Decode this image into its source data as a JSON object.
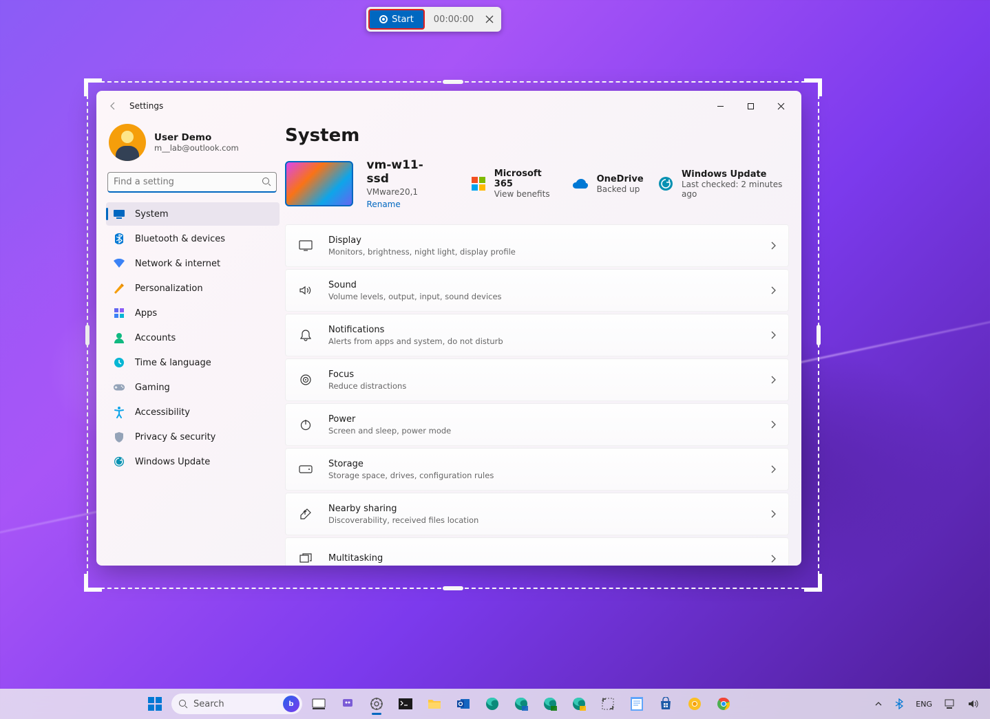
{
  "recorder": {
    "start_label": "Start",
    "time": "00:00:00"
  },
  "window": {
    "title": "Settings"
  },
  "user": {
    "name": "User Demo",
    "email": "m__lab@outlook.com"
  },
  "search": {
    "placeholder": "Find a setting"
  },
  "nav": [
    {
      "key": "system",
      "label": "System",
      "active": true,
      "color": "#0067c0"
    },
    {
      "key": "bluetooth",
      "label": "Bluetooth & devices",
      "color": "#0078d4"
    },
    {
      "key": "network",
      "label": "Network & internet",
      "color": "#3b82f6"
    },
    {
      "key": "personalization",
      "label": "Personalization",
      "color": "#f59e0b"
    },
    {
      "key": "apps",
      "label": "Apps",
      "color": "#6366f1"
    },
    {
      "key": "accounts",
      "label": "Accounts",
      "color": "#10b981"
    },
    {
      "key": "time",
      "label": "Time & language",
      "color": "#06b6d4"
    },
    {
      "key": "gaming",
      "label": "Gaming",
      "color": "#64748b"
    },
    {
      "key": "accessibility",
      "label": "Accessibility",
      "color": "#0ea5e9"
    },
    {
      "key": "privacy",
      "label": "Privacy & security",
      "color": "#94a3b8"
    },
    {
      "key": "update",
      "label": "Windows Update",
      "color": "#0891b2"
    }
  ],
  "page": {
    "title": "System"
  },
  "device": {
    "name": "vm-w11-ssd",
    "model": "VMware20,1",
    "rename": "Rename"
  },
  "info_cards": {
    "m365": {
      "label": "Microsoft 365",
      "sub": "View benefits"
    },
    "onedrive": {
      "label": "OneDrive",
      "sub": "Backed up"
    },
    "update": {
      "label": "Windows Update",
      "sub": "Last checked: 2 minutes ago"
    }
  },
  "cards": [
    {
      "key": "display",
      "title": "Display",
      "sub": "Monitors, brightness, night light, display profile"
    },
    {
      "key": "sound",
      "title": "Sound",
      "sub": "Volume levels, output, input, sound devices"
    },
    {
      "key": "notifications",
      "title": "Notifications",
      "sub": "Alerts from apps and system, do not disturb"
    },
    {
      "key": "focus",
      "title": "Focus",
      "sub": "Reduce distractions"
    },
    {
      "key": "power",
      "title": "Power",
      "sub": "Screen and sleep, power mode"
    },
    {
      "key": "storage",
      "title": "Storage",
      "sub": "Storage space, drives, configuration rules"
    },
    {
      "key": "nearby",
      "title": "Nearby sharing",
      "sub": "Discoverability, received files location"
    },
    {
      "key": "multitasking",
      "title": "Multitasking",
      "sub": ""
    }
  ],
  "taskbar": {
    "search": "Search",
    "lang": "ENG"
  }
}
